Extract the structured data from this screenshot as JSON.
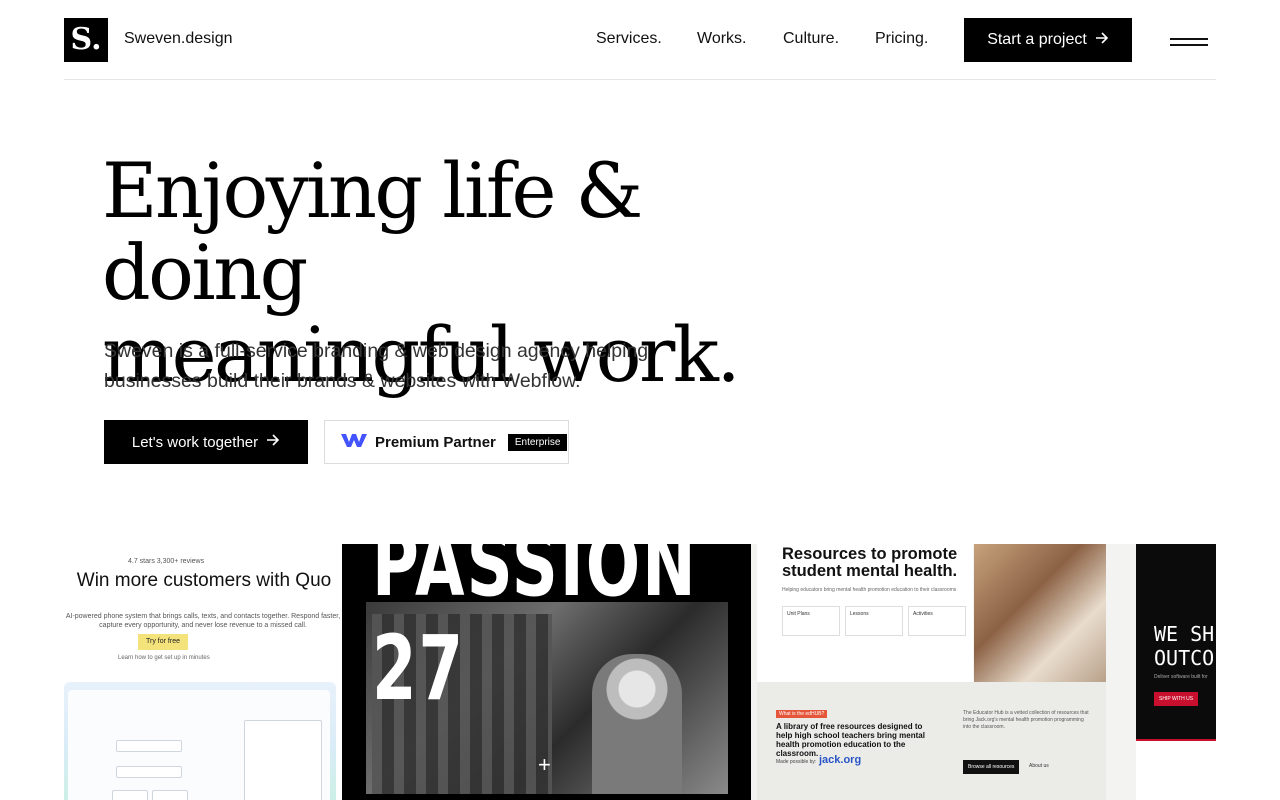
{
  "header": {
    "logo_letter": "S.",
    "brand": "Sweven.design",
    "nav": [
      "Services.",
      "Works.",
      "Culture.",
      "Pricing."
    ],
    "cta_label": "Start a project",
    "cta_icon": "arrow-right-icon",
    "menu_icon": "hamburger-menu-icon"
  },
  "hero": {
    "headline_line1": "Enjoying life & doing",
    "headline_line2": "meaningful work.",
    "subtext": "Sweven is a full-service branding & web design agency helping businesses build their brands & websites with Webflow.",
    "primary_button": "Let's work together",
    "partner_badge": {
      "logo_icon": "webflow-logo-icon",
      "label": "Premium Partner",
      "tag": "Enterprise"
    }
  },
  "showcase": {
    "quo": {
      "rating": "4.7 stars   3,300+ reviews",
      "title": "Win more customers with Quo",
      "description": "AI-powered phone system that brings calls, texts, and contacts together. Respond faster, capture every opportunity, and never lose revenue to a missed call.",
      "button": "Try for free",
      "learn": "Learn how to get set up in minutes"
    },
    "passion": {
      "word": "PASSION 27"
    },
    "jack": {
      "title": "Resources to promote student mental health.",
      "description": "Helping educators bring mental health promotion education to their classrooms",
      "chips": [
        "Unit Plans",
        "Lessons",
        "Activities"
      ],
      "what_label": "What is the edHUB?",
      "bottom_title": "A library of free resources designed to help high school teachers bring mental health promotion education to the classroom.",
      "made_by": "Made possible by:",
      "jack_logo": "jack.org",
      "bottom_desc": "The Educator Hub is a vetted collection of resources that bring Jack.org's mental health promotion programming into the classroom.",
      "browse_button": "Browse all resources",
      "about_link": "About us"
    },
    "ship": {
      "headline_line1": "WE SH",
      "headline_line2": "OUTCO",
      "small": "Deliver software built for",
      "button": "SHIP WITH US"
    }
  },
  "colors": {
    "primary": "#000000",
    "background": "#ffffff",
    "text": "#333333",
    "ship_accent": "#c8102e",
    "webflow_blue": "#4353ff"
  }
}
